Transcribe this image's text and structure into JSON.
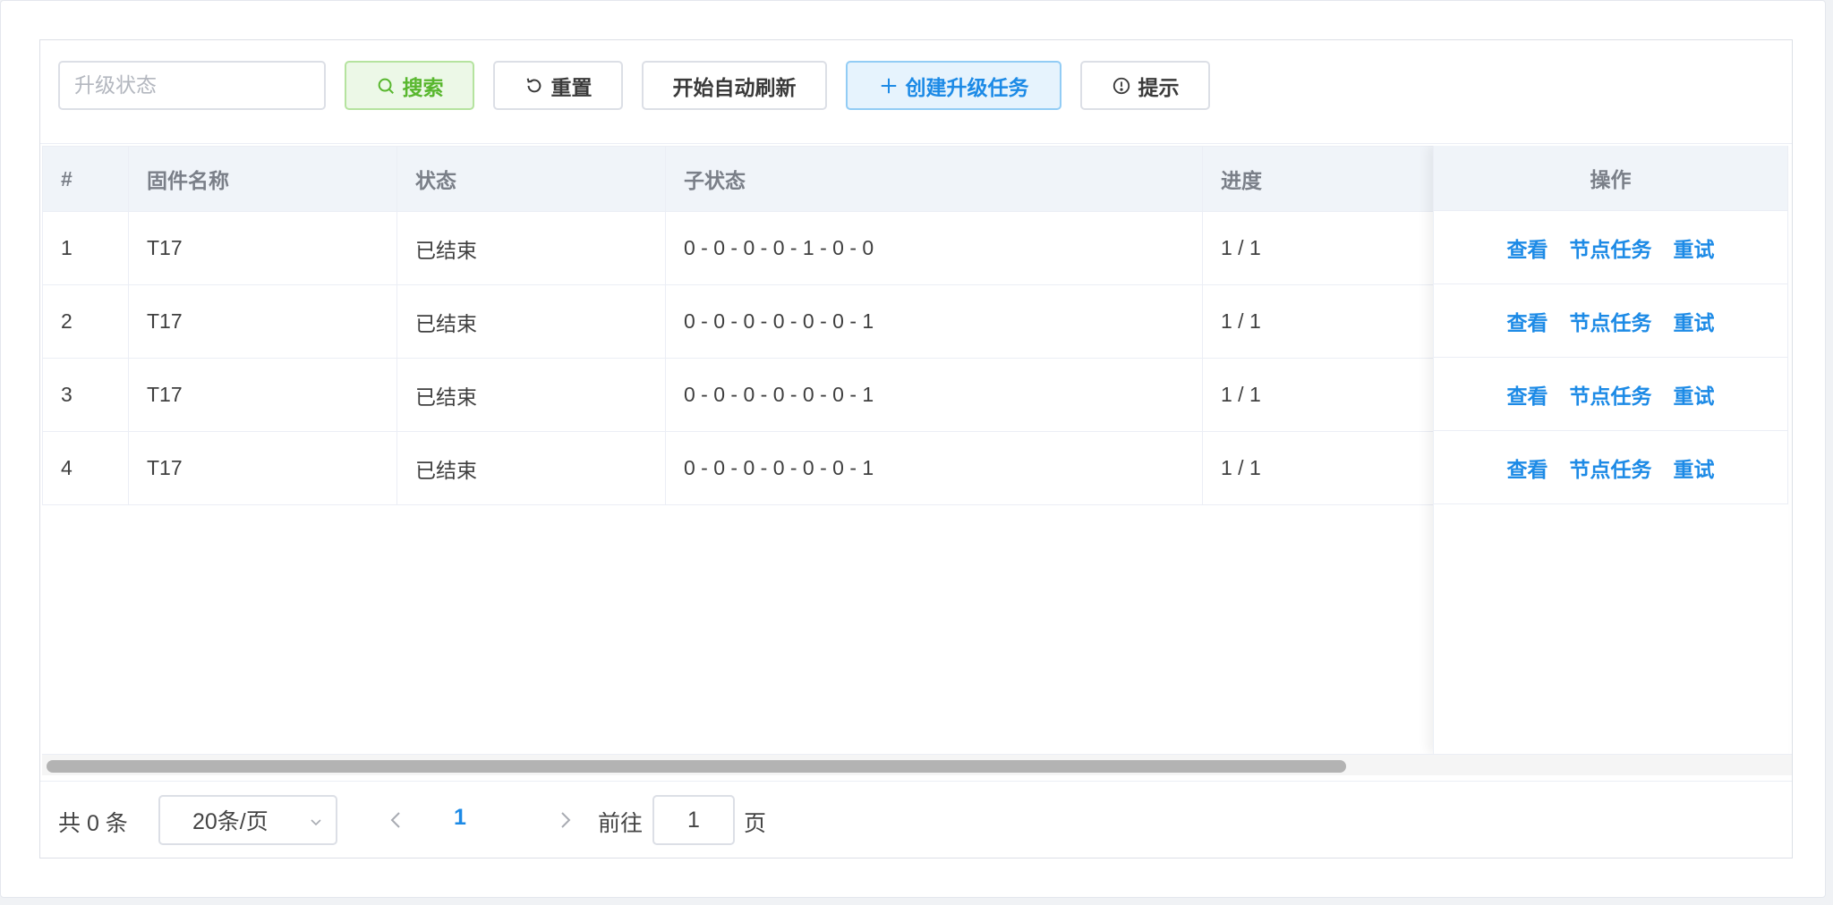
{
  "toolbar": {
    "search_placeholder": "升级状态",
    "search_label": "搜索",
    "reset_label": "重置",
    "auto_refresh_label": "开始自动刷新",
    "create_label": "创建升级任务",
    "hint_label": "提示"
  },
  "table": {
    "headers": [
      "#",
      "固件名称",
      "状态",
      "子状态",
      "进度",
      "操作"
    ],
    "rows": [
      {
        "index": "1",
        "firmware": "T17",
        "status": "已结束",
        "sub_status": "0 - 0 - 0 - 0 - 1 - 0 - 0",
        "progress": "1 / 1"
      },
      {
        "index": "2",
        "firmware": "T17",
        "status": "已结束",
        "sub_status": "0 - 0 - 0 - 0 - 0 - 0 - 1",
        "progress": "1 / 1"
      },
      {
        "index": "3",
        "firmware": "T17",
        "status": "已结束",
        "sub_status": "0 - 0 - 0 - 0 - 0 - 0 - 1",
        "progress": "1 / 1"
      },
      {
        "index": "4",
        "firmware": "T17",
        "status": "已结束",
        "sub_status": "0 - 0 - 0 - 0 - 0 - 0 - 1",
        "progress": "1 / 1"
      }
    ],
    "actions": {
      "view": "查看",
      "node_tasks": "节点任务",
      "retry": "重试"
    }
  },
  "pager": {
    "total": "共 0 条",
    "page_size": "20条/页",
    "current_page": "1",
    "goto_label": "前往",
    "goto_value": "1",
    "goto_suffix": "页"
  }
}
